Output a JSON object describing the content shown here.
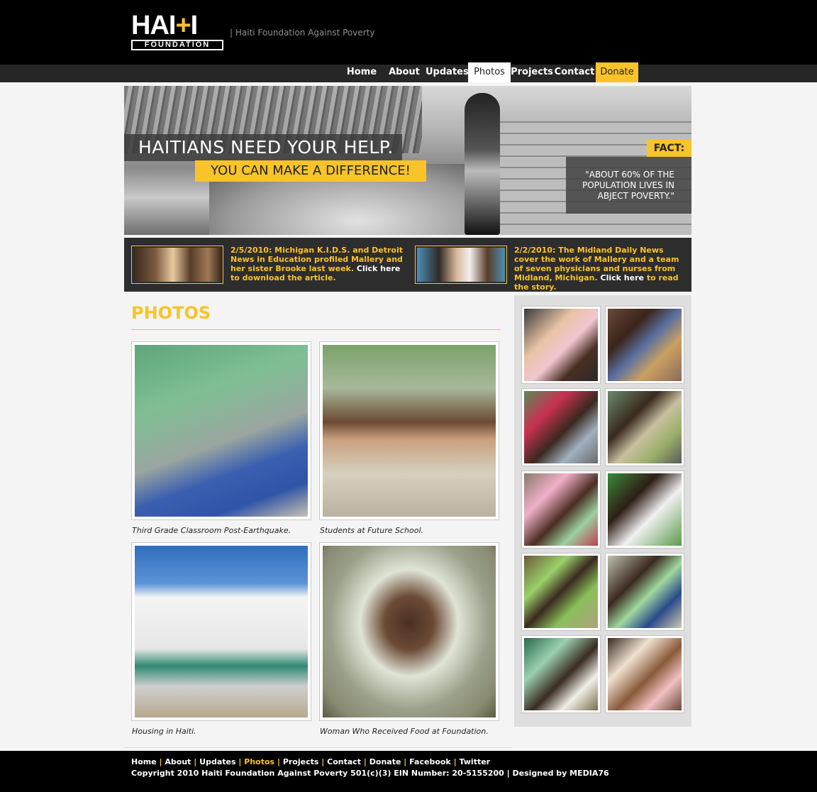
{
  "header": {
    "logo_text": "HAITI",
    "logo_sub": "FOUNDATION",
    "tagline": "| Haiti Foundation Against Poverty"
  },
  "nav": {
    "items": [
      "Home",
      "About",
      "Updates",
      "Photos",
      "Projects",
      "Contact",
      "Donate"
    ],
    "active": "Photos",
    "accent_color": "#f9c32a"
  },
  "hero": {
    "headline": "HAITIANS NEED YOUR HELP.",
    "subhead": "YOU CAN MAKE A DIFFERENCE!",
    "fact_label": "FACT:",
    "fact_text": "\"ABOUT 60% OF THE POPULATION LIVES IN ABJECT POVERTY.\""
  },
  "news": [
    {
      "text": "2/5/2010: Michigan K.I.D.S. and Detroit News in Education profiled Mallery and her sister Brooke last week.",
      "link": "Click here",
      "after": "to download the article."
    },
    {
      "text": "2/2/2010: The Midland Daily News cover the work of Mallery and a team of seven physicians and nurses from Midland, Michigan.",
      "link": "Click here",
      "after": "to read the story."
    }
  ],
  "main": {
    "title": "PHOTOS",
    "photos": [
      {
        "caption": "Third Grade Classroom Post-Earthquake."
      },
      {
        "caption": "Students at Future School."
      },
      {
        "caption": "Housing in Haiti."
      },
      {
        "caption": "Woman Who Received Food at Foundation."
      }
    ]
  },
  "footer": {
    "links": [
      "Home",
      "About",
      "Updates",
      "Photos",
      "Projects",
      "Contact",
      "Donate",
      "Facebook",
      "Twitter"
    ],
    "active": "Photos",
    "copyright": "Copyright 2010 Haiti Foundation Against Poverty 501(c)(3) EIN Number: 20-5155200 | Designed by MEDIA76"
  }
}
